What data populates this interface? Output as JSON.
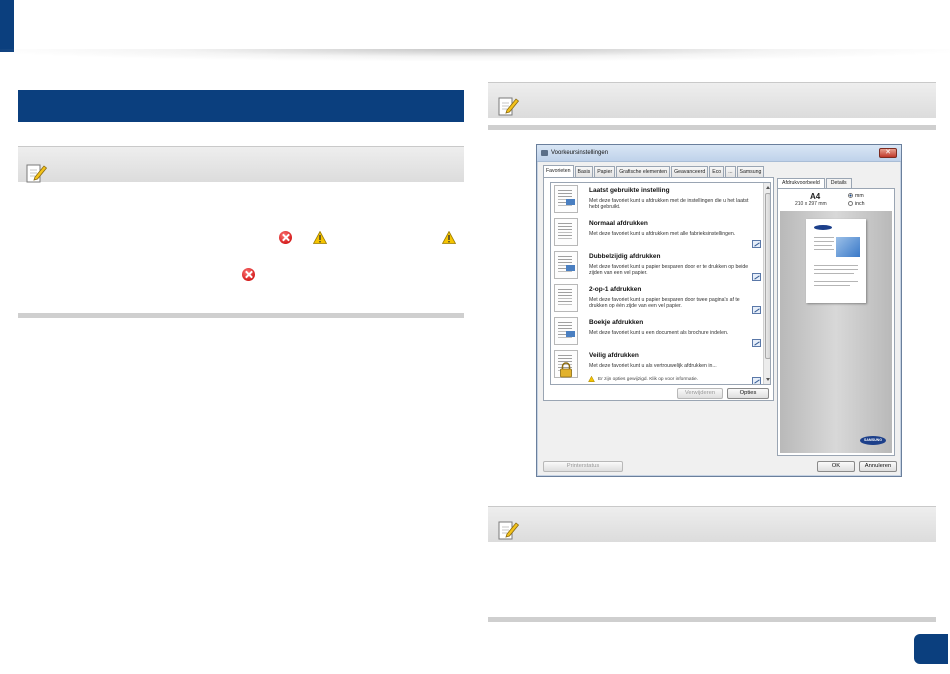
{
  "dialog": {
    "title": "Voorkeursinstellingen",
    "close_label": "✕",
    "tabs": [
      "Favorieten",
      "Basis",
      "Papier",
      "Grafische elementen",
      "Geavanceerd",
      "Eco",
      "...",
      "Samsung"
    ],
    "favorites": [
      {
        "title": "Laatst gebruikte instelling",
        "desc": "Met deze favoriet kunt u afdrukken met de instellingen die u het laatst hebt gebruikt."
      },
      {
        "title": "Normaal afdrukken",
        "desc": "Met deze favoriet kunt u afdrukken met alle fabrieksinstellingen."
      },
      {
        "title": "Dubbelzijdig afdrukken",
        "desc": "Met deze favoriet kunt u papier besparen door er te drukken op beide zijden van een vel papier."
      },
      {
        "title": "2-op-1 afdrukken",
        "desc": "Met deze favoriet kunt u papier besparen door twee pagina's af te drukken op één zijde van een vel papier."
      },
      {
        "title": "Boekje afdrukken",
        "desc": "Met deze favoriet kunt u een document als brochure indelen."
      },
      {
        "title": "Veilig afdrukken",
        "desc": "Met deze favoriet kunt u als vertrouwelijk afdrukken in..."
      }
    ],
    "warning_line": "Er zijn opties gewijzigd. Klik op voor informatie.",
    "delete_label": "Verwijderen",
    "options_label": "Opties",
    "preview_tabs": [
      "Afdrukvoorbeeld",
      "Details"
    ],
    "paper_size": "A4",
    "paper_dims": "210 x 297 mm",
    "unit_mm": "mm",
    "unit_inch": "inch",
    "brand": "SAMSUNG",
    "printer_status_label": "Printerstatus",
    "ok_label": "OK",
    "cancel_label": "Annuleren"
  }
}
